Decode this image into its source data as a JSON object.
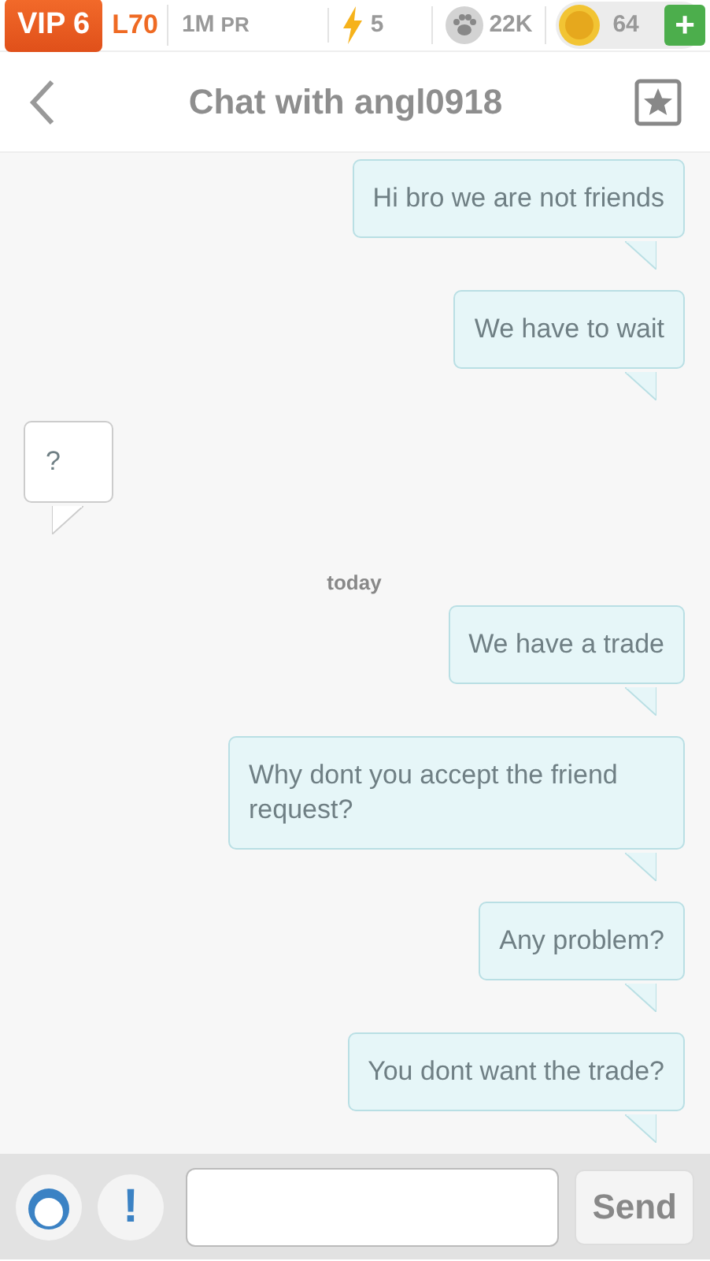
{
  "status_bar": {
    "vip": "VIP 6",
    "level": "L70",
    "pr_value": "1M",
    "pr_unit": "PR",
    "energy": "5",
    "paws": "22K",
    "coins": "64",
    "add": "+"
  },
  "header": {
    "title": "Chat with angl0918"
  },
  "messages": [
    {
      "kind": "sent",
      "text": "Hi bro we are not friends"
    },
    {
      "kind": "sent",
      "text": "We have to wait"
    },
    {
      "kind": "received",
      "text": "?"
    },
    {
      "kind": "date",
      "text": "today"
    },
    {
      "kind": "sent",
      "text": "We have a trade"
    },
    {
      "kind": "sent",
      "text": "Why dont you accept the friend request?"
    },
    {
      "kind": "sent",
      "text": "Any problem?"
    },
    {
      "kind": "sent",
      "text": "You dont want the trade?"
    }
  ],
  "composer": {
    "alert": "!",
    "send": "Send"
  }
}
